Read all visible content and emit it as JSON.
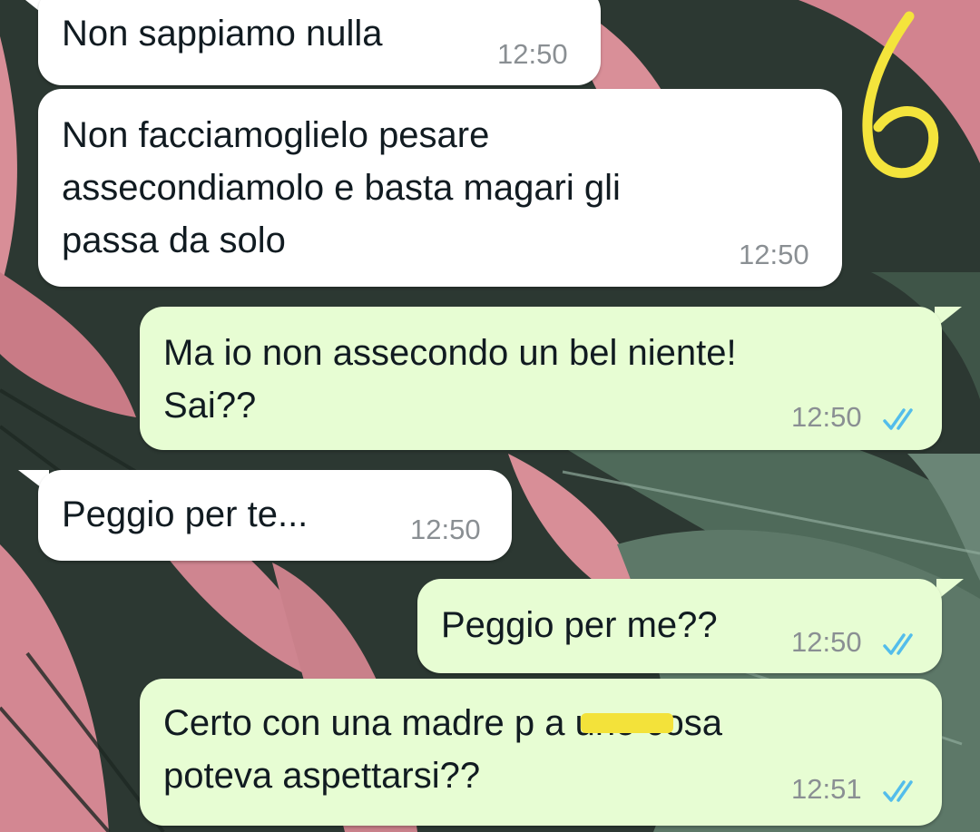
{
  "conversation": {
    "messages": [
      {
        "direction": "incoming",
        "text": "Non sappiamo nulla",
        "time": "12:50"
      },
      {
        "direction": "incoming",
        "text": "Non facciamoglielo pesare\nassecondiamolo e basta magari gli\npassa da solo",
        "time": "12:50"
      },
      {
        "direction": "outgoing",
        "text": "Ma io non assecondo un bel niente!\nSai??",
        "time": "12:50",
        "status": "read-double-check-icon"
      },
      {
        "direction": "incoming",
        "text": "Peggio per te...",
        "time": "12:50"
      },
      {
        "direction": "outgoing",
        "text": "Peggio per me??",
        "time": "12:50",
        "status": "read-double-check-icon"
      },
      {
        "direction": "outgoing",
        "text": "Certo con una madre p   a uno cosa\npoteva aspettarsi??",
        "time": "12:51",
        "status": "read-double-check-icon"
      }
    ]
  },
  "annotation": {
    "label": "6",
    "color": "#f4e43c"
  },
  "colors": {
    "incoming_bubble": "#ffffff",
    "outgoing_bubble": "#e7fdd3",
    "read_ticks": "#53bdeb",
    "censor_highlight": "#f3e23a"
  }
}
